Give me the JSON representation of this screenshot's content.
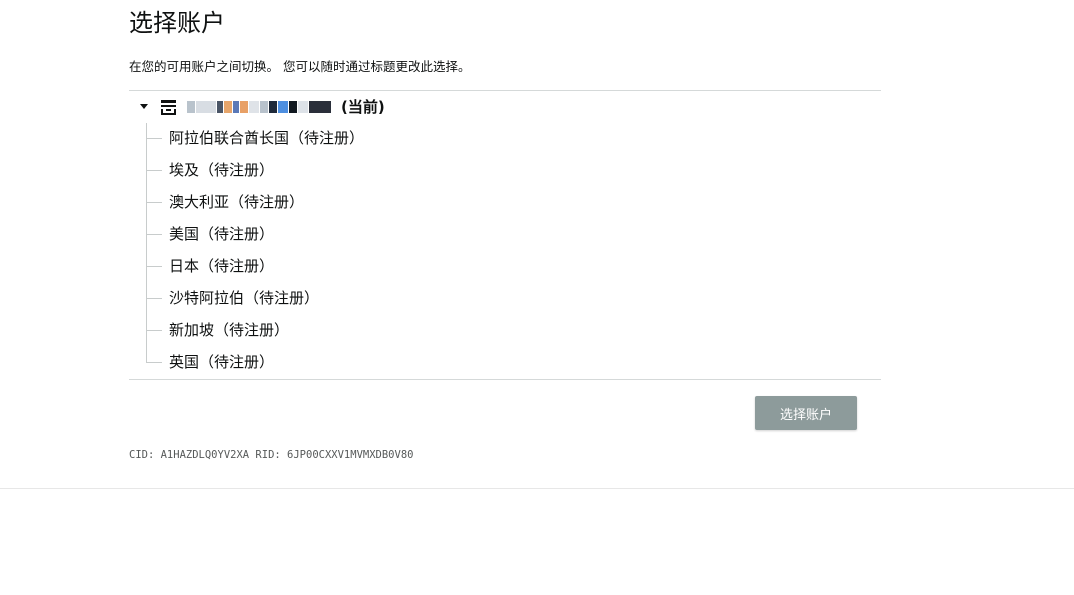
{
  "header": {
    "title": "选择账户",
    "subtitle": "在您的可用账户之间切换。 您可以随时通过标题更改此选择。"
  },
  "account_tree": {
    "current_account_label": "(当前)",
    "current_account_expanded": true,
    "icons": {
      "expand": "caret-down-icon",
      "account": "store-icon"
    },
    "marketplaces": [
      {
        "label": "阿拉伯联合酋长国（待注册）"
      },
      {
        "label": "埃及（待注册）"
      },
      {
        "label": "澳大利亚（待注册）"
      },
      {
        "label": "美国（待注册）"
      },
      {
        "label": "日本（待注册）"
      },
      {
        "label": "沙特阿拉伯（待注册）"
      },
      {
        "label": "新加坡（待注册）"
      },
      {
        "label": "英国（待注册）"
      }
    ]
  },
  "actions": {
    "select_button_label": "选择账户"
  },
  "footer": {
    "ids_text": "CID: A1HAZDLQ0YV2XA RID: 6JP00CXXV1MVMXDB0V80"
  },
  "colors": {
    "button_disabled_bg": "#8d9b9b",
    "divider": "#d5d9d9",
    "text": "#0f1111"
  }
}
